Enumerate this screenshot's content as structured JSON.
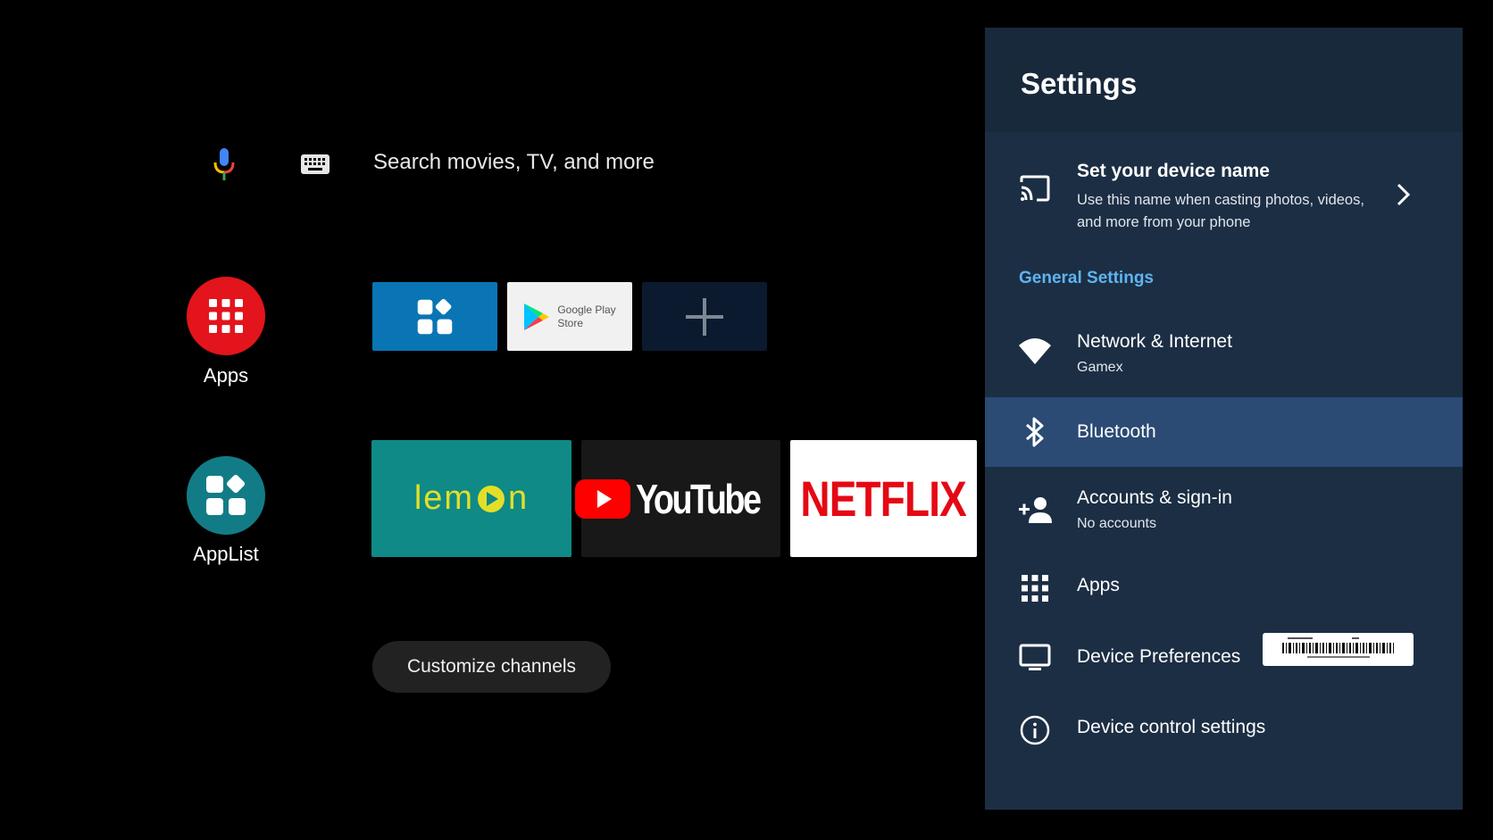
{
  "search": {
    "placeholder": "Search movies, TV, and more"
  },
  "launcher": {
    "apps_label": "Apps",
    "applist_label": "AppList"
  },
  "favorites": {
    "play_store_line1": "Google Play",
    "play_store_line2": "Store"
  },
  "channels": {
    "lemon": "lem",
    "lemon_end": "n",
    "youtube": "YouTube",
    "netflix": "NETFLIX"
  },
  "customize_label": "Customize channels",
  "settings": {
    "title": "Settings",
    "device_name": {
      "title": "Set your device name",
      "desc_line1": "Use this name when casting photos, videos,",
      "desc_line2": "and more from your phone"
    },
    "section_label": "General Settings",
    "items": [
      {
        "label": "Network & Internet",
        "sub": "Gamex",
        "icon": "wifi-icon"
      },
      {
        "label": "Bluetooth",
        "icon": "bluetooth-icon"
      },
      {
        "label": "Accounts & sign-in",
        "sub": "No accounts",
        "icon": "add-person-icon"
      },
      {
        "label": "Apps",
        "icon": "grid-icon"
      },
      {
        "label": "Device Preferences",
        "icon": "monitor-icon"
      },
      {
        "label": "Device control settings",
        "icon": "info-icon"
      }
    ]
  },
  "colors": {
    "panel": "#1c2e44",
    "selected_row": "#2b4a74",
    "section": "#5fb4f0",
    "apps_circle": "#e3141b",
    "applist_circle": "#127c86"
  }
}
